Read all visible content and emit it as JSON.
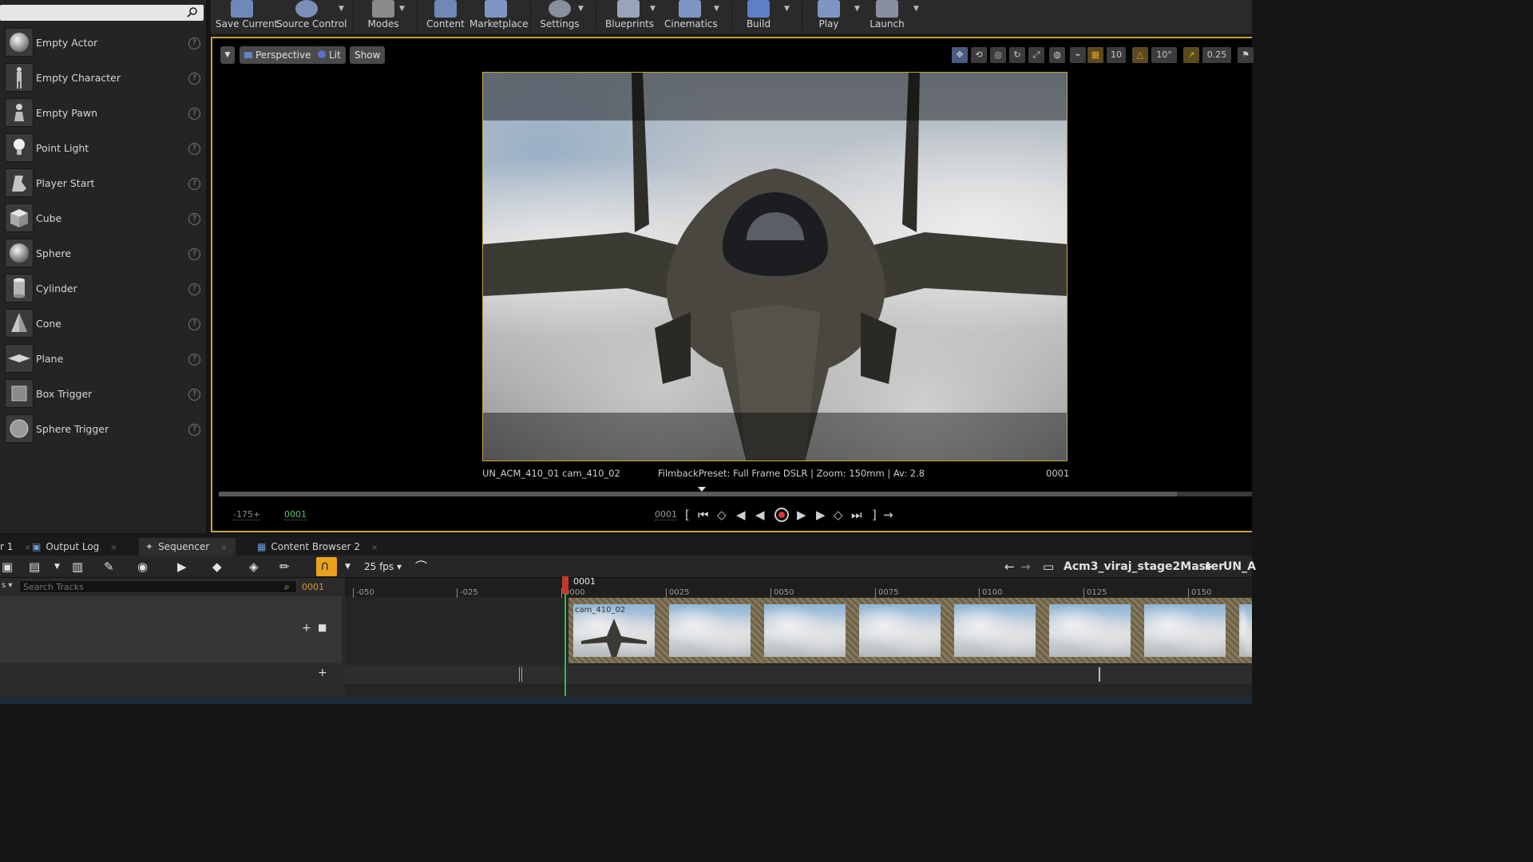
{
  "toolbar": {
    "buttons": [
      {
        "label": "Save Current"
      },
      {
        "label": "Source Control"
      },
      {
        "label": "Modes"
      },
      {
        "label": "Content"
      },
      {
        "label": "Marketplace"
      },
      {
        "label": "Settings"
      },
      {
        "label": "Blueprints"
      },
      {
        "label": "Cinematics"
      },
      {
        "label": "Build"
      },
      {
        "label": "Play"
      },
      {
        "label": "Launch"
      }
    ]
  },
  "place_panel": {
    "items": [
      {
        "label": "Empty Actor"
      },
      {
        "label": "Empty Character"
      },
      {
        "label": "Empty Pawn"
      },
      {
        "label": "Point Light"
      },
      {
        "label": "Player Start"
      },
      {
        "label": "Cube"
      },
      {
        "label": "Sphere"
      },
      {
        "label": "Cylinder"
      },
      {
        "label": "Cone"
      },
      {
        "label": "Plane"
      },
      {
        "label": "Box Trigger"
      },
      {
        "label": "Sphere Trigger"
      }
    ],
    "help_glyph": "?"
  },
  "viewport": {
    "perspective_label": "Perspective",
    "lit_label": "Lit",
    "show_label": "Show",
    "grid_snap": "10",
    "rot_snap": "10°",
    "scale_snap": "0.25",
    "shot_info": "UN_ACM_410_01  cam_410_02",
    "filmback_info": "FilmbackPreset: Full Frame DSLR | Zoom: 150mm | Av: 2.8",
    "frame_right": "0001",
    "range_start": "-175+",
    "current_frame_green": "0001",
    "transport_frame": "0001"
  },
  "tabs": [
    {
      "label": "r 1"
    },
    {
      "label": "Output Log"
    },
    {
      "label": "Sequencer"
    },
    {
      "label": "Content Browser 2"
    }
  ],
  "sequencer": {
    "fps_label": "25 fps",
    "breadcrumb_master": "Acm3_viraj_stage2Master",
    "breadcrumb_next": "UN_A",
    "search_placeholder": "Search Tracks",
    "current_frame": "0001",
    "playhead_label": "0001",
    "ruler_ticks": [
      "-050",
      "-025",
      "0000",
      "0025",
      "0050",
      "0075",
      "0100",
      "0125",
      "0150"
    ],
    "shot_label": "cam_410_02"
  },
  "colors": {
    "accent": "#c9a43a",
    "snap_active": "#e8a21e",
    "playhead": "#2fbf4a",
    "record": "#d93636"
  }
}
